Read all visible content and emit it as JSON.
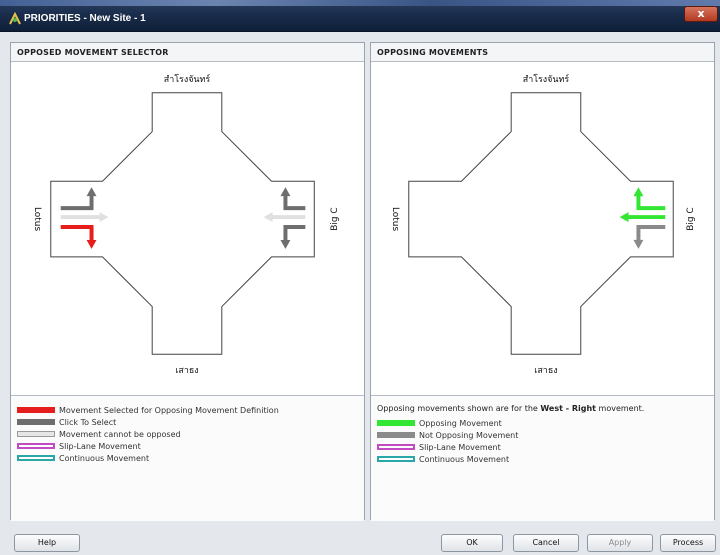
{
  "window": {
    "title": "PRIORITIES - New Site - 1",
    "close_label": "x"
  },
  "left_panel": {
    "title": "OPPOSED MOVEMENT SELECTOR",
    "streets": {
      "north": "สำโรงจันทร์",
      "south": "เสาธง",
      "west": "Lotus",
      "east": "Big C"
    },
    "legend": [
      {
        "label": "Movement Selected for Opposing Movement Definition",
        "color": "#e61d1d"
      },
      {
        "label": "Click To Select",
        "color": "#6e6e6e"
      },
      {
        "label": "Movement cannot be opposed",
        "color": "#e6e6e6"
      },
      {
        "label": "Slip-Lane Movement",
        "color": "#c14bc1"
      },
      {
        "label": "Continuous Movement",
        "color": "#2aa7a7"
      }
    ]
  },
  "right_panel": {
    "title": "OPPOSING MOVEMENTS",
    "streets": {
      "north": "สำโรงจันทร์",
      "south": "เสาธง",
      "west": "Lotus",
      "east": "Big C"
    },
    "info": {
      "prefix": "Opposing movements shown are for the ",
      "movement": "West - Right",
      "suffix": " movement."
    },
    "legend": [
      {
        "label": "Opposing Movement",
        "color": "#33e633"
      },
      {
        "label": "Not Opposing Movement",
        "color": "#8a8a8a"
      },
      {
        "label": "Slip-Lane Movement",
        "color": "#c14bc1"
      },
      {
        "label": "Continuous Movement",
        "color": "#2aa7a7"
      }
    ]
  },
  "buttons": {
    "help": "Help",
    "ok": "OK",
    "cancel": "Cancel",
    "apply": "Apply",
    "process": "Process"
  }
}
